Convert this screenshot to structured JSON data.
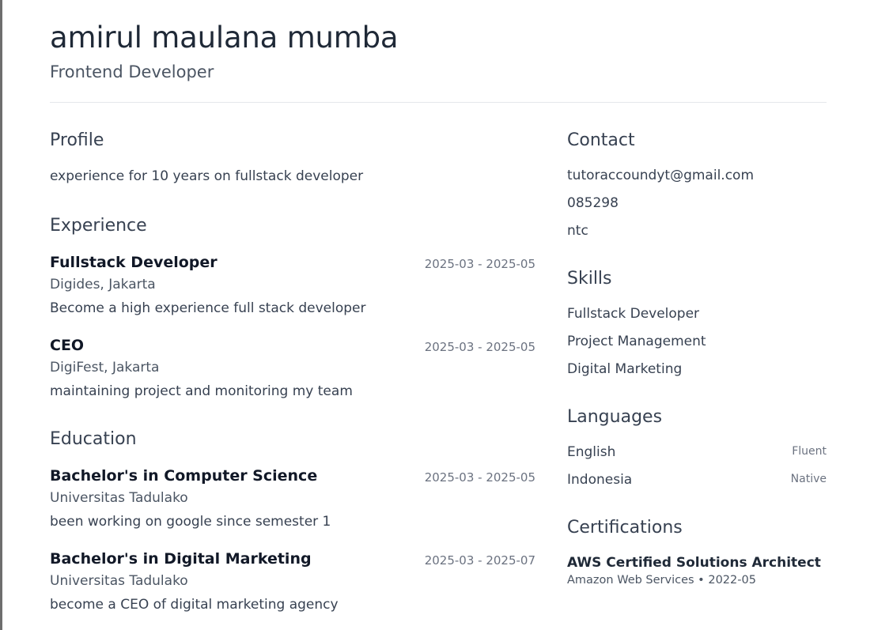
{
  "header": {
    "name": "amirul maulana mumba",
    "role": "Frontend Developer"
  },
  "profile": {
    "title": "Profile",
    "summary": "experience for 10 years on fullstack developer"
  },
  "experience": {
    "title": "Experience",
    "items": [
      {
        "position": "Fullstack Developer",
        "dates": "2025-03 - 2025-05",
        "org": "Digides, Jakarta",
        "description": "Become a high experience full stack developer"
      },
      {
        "position": "CEO",
        "dates": "2025-03 - 2025-05",
        "org": "DigiFest, Jakarta",
        "description": "maintaining project and monitoring my team"
      }
    ]
  },
  "education": {
    "title": "Education",
    "items": [
      {
        "degree": "Bachelor's in Computer Science",
        "dates": "2025-03 - 2025-05",
        "school": "Universitas Tadulako",
        "description": "been working on google since semester 1"
      },
      {
        "degree": "Bachelor's in Digital Marketing",
        "dates": "2025-03 - 2025-07",
        "school": "Universitas Tadulako",
        "description": "become a CEO of digital marketing agency"
      }
    ]
  },
  "contact": {
    "title": "Contact",
    "email": "tutoraccoundyt@gmail.com",
    "phone": "085298",
    "location": "ntc"
  },
  "skills": {
    "title": "Skills",
    "items": [
      "Fullstack Developer",
      "Project Management",
      "Digital Marketing"
    ]
  },
  "languages": {
    "title": "Languages",
    "items": [
      {
        "name": "English",
        "level": "Fluent"
      },
      {
        "name": "Indonesia",
        "level": "Native"
      }
    ]
  },
  "certifications": {
    "title": "Certifications",
    "items": [
      {
        "name": "AWS Certified Solutions Architect",
        "meta": "Amazon Web Services • 2022-05"
      }
    ]
  }
}
